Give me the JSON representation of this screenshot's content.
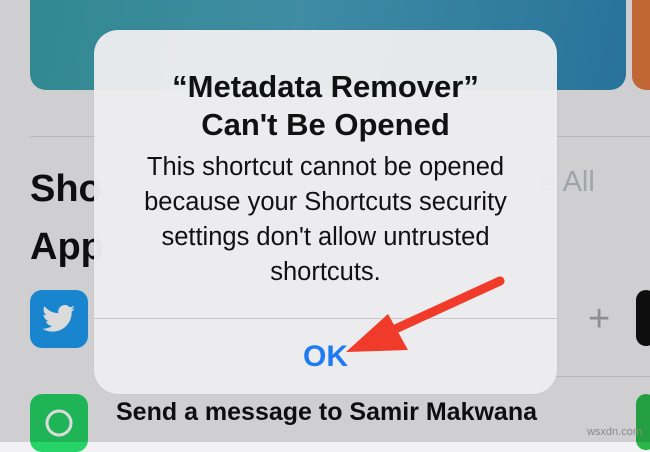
{
  "background": {
    "section_title": "Shortcuts for Your Apps",
    "section_title_visible": "Sho App",
    "see_all_label": "See All",
    "see_all_visible": "e All",
    "add_symbol": "+",
    "row_text": "Send a message to Samir Makwana"
  },
  "alert": {
    "title_line1": "“Metadata Remover”",
    "title_line2": "Can't Be Opened",
    "message": "This shortcut cannot be opened because your Shortcuts security settings don't allow untrusted shortcuts.",
    "ok_label": "OK"
  },
  "annotation": {
    "arrow_color": "#f03a2a"
  },
  "watermark": "wsxdn.com",
  "colors": {
    "ios_blue": "#1f7bf2",
    "alert_bg": "#ececee",
    "twitter": "#1d9bf0",
    "whatsapp": "#25d366"
  }
}
